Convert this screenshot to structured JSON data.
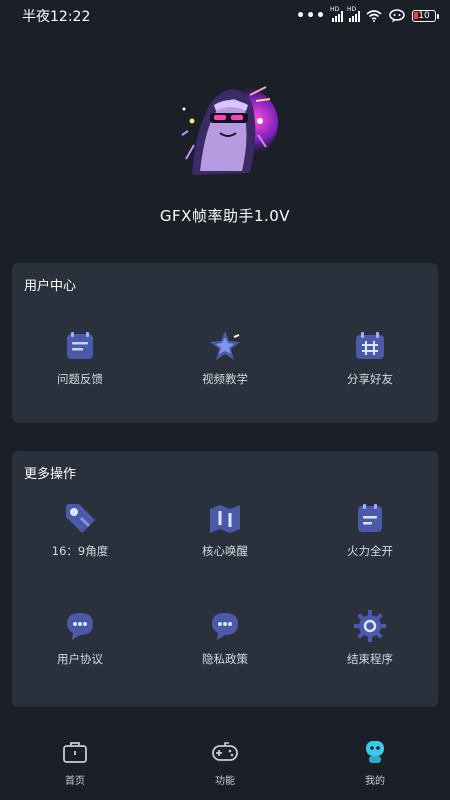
{
  "status_bar": {
    "time": "半夜12:22",
    "dots": "•••",
    "battery": "10"
  },
  "app": {
    "title": "GFX帧率助手1.0V"
  },
  "user_center": {
    "title": "用户中心",
    "items": [
      {
        "label": "问题反馈",
        "icon": "feedback-icon"
      },
      {
        "label": "视频教学",
        "icon": "star-icon"
      },
      {
        "label": "分享好友",
        "icon": "share-icon"
      }
    ]
  },
  "more_actions": {
    "title": "更多操作",
    "items": [
      {
        "label": "16：9角度",
        "icon": "tag-icon"
      },
      {
        "label": "核心唤醒",
        "icon": "map-icon"
      },
      {
        "label": "火力全开",
        "icon": "note-icon"
      },
      {
        "label": "用户协议",
        "icon": "chat-icon"
      },
      {
        "label": "隐私政策",
        "icon": "chat-icon"
      },
      {
        "label": "结束程序",
        "icon": "gear-icon"
      }
    ]
  },
  "bottom_nav": {
    "items": [
      {
        "label": "首页",
        "icon": "briefcase-icon"
      },
      {
        "label": "功能",
        "icon": "gamepad-icon"
      },
      {
        "label": "我的",
        "icon": "robot-icon"
      }
    ]
  },
  "colors": {
    "background": "#1b1f28",
    "card": "#2a313d",
    "icon_fill": "#4b5aa8",
    "icon_accent": "#7f95e8",
    "nav_active": "#3cc8e8"
  }
}
